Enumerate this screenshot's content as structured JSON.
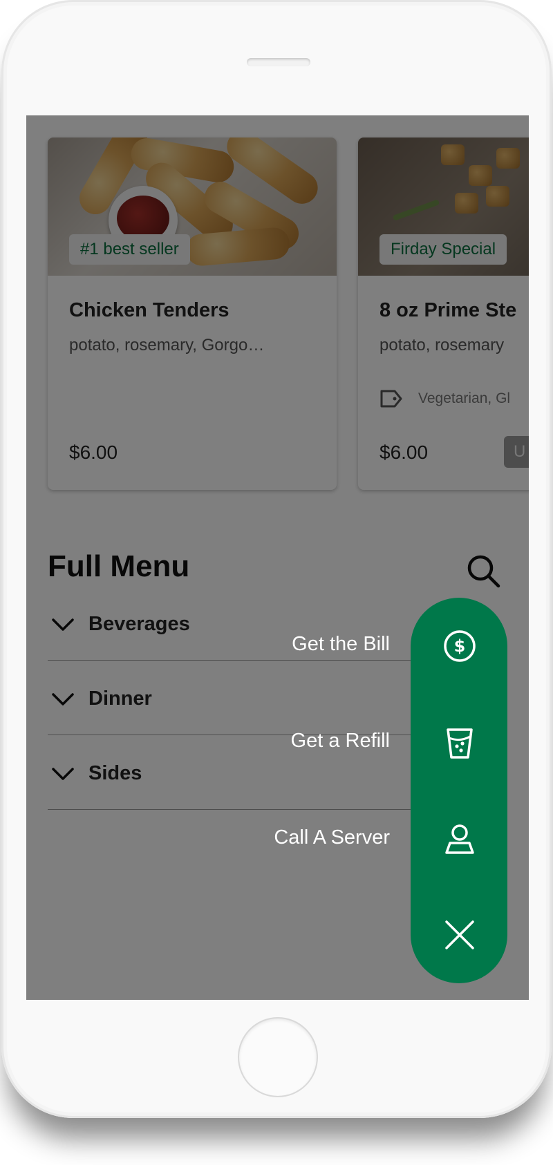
{
  "featured": [
    {
      "badge": "#1 best seller",
      "title": "Chicken Tenders",
      "description": "potato, rosemary, Gorgo…",
      "price": "$6.00"
    },
    {
      "badge": "Firday Special",
      "title": "8 oz Prime Ste",
      "description": "potato, rosemary",
      "tags": "Vegetarian, Gl",
      "price": "$6.00",
      "button_label": "U"
    }
  ],
  "menu": {
    "title": "Full Menu",
    "categories": [
      {
        "label": "Beverages"
      },
      {
        "label": "Dinner"
      },
      {
        "label": "Sides"
      }
    ]
  },
  "fab_actions": [
    {
      "label": "Get the Bill",
      "icon": "dollar-icon"
    },
    {
      "label": "Get a Refill",
      "icon": "drink-icon"
    },
    {
      "label": "Call A Server",
      "icon": "server-icon"
    }
  ],
  "fab_close_icon": "close-icon",
  "colors": {
    "accent": "#00784a",
    "badge_text": "#0a6f3f",
    "overlay": "rgba(0,0,0,0.5)"
  }
}
